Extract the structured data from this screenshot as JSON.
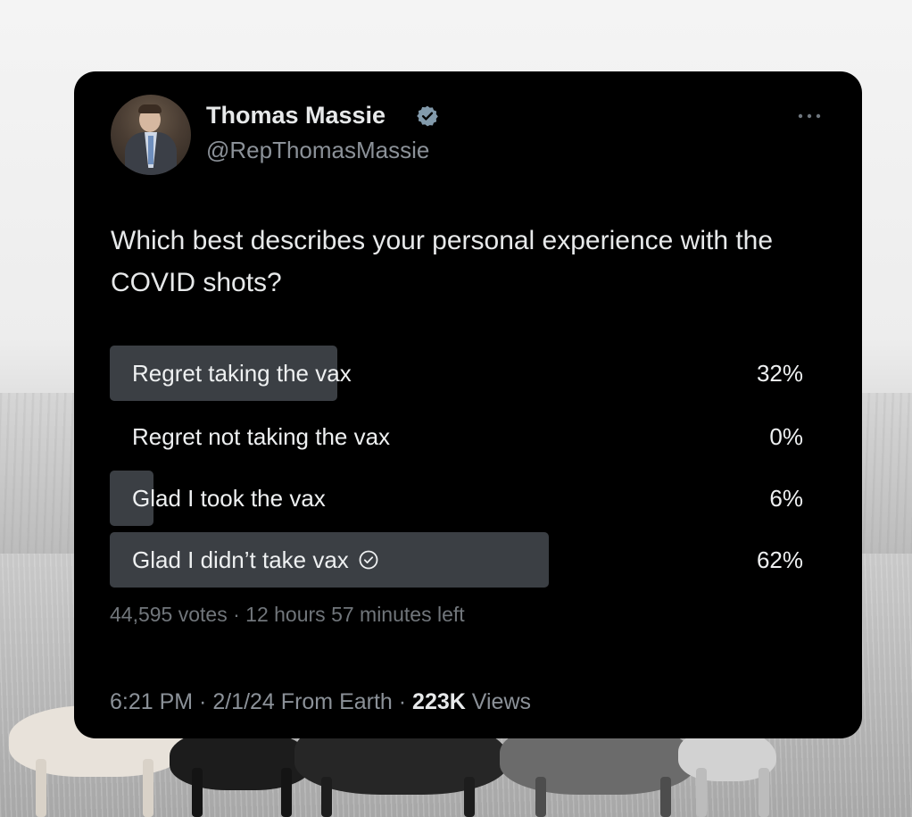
{
  "tweet": {
    "author_name": "Thomas Massie",
    "author_handle": "@RepThomasMassie",
    "verified_icon": "verified-badge-icon",
    "more_icon": "more-options-icon",
    "text": "Which best describes your personal experience with the COVID shots?",
    "poll": {
      "options": [
        {
          "label": "Regret taking the vax",
          "percent_text": "32%",
          "percent": 32,
          "chosen": false
        },
        {
          "label": "Regret not taking the vax",
          "percent_text": "0%",
          "percent": 0,
          "chosen": false
        },
        {
          "label": "Glad I took the vax",
          "percent_text": "6%",
          "percent": 6,
          "chosen": false
        },
        {
          "label": "Glad I didn’t take vax",
          "percent_text": "62%",
          "percent": 62,
          "chosen": true
        }
      ],
      "votes": "44,595 votes",
      "separator": " · ",
      "time_left": "12 hours 57 minutes left"
    },
    "footer": {
      "time": "6:21 PM",
      "date": "2/1/24",
      "source": "From Earth",
      "views_count": "223K",
      "views_label": "Views",
      "separator": " · "
    }
  },
  "colors": {
    "card_background": "#000000",
    "poll_bar": "#3b3f44",
    "verified_badge": "#829aab",
    "muted_text": "#71767b"
  }
}
